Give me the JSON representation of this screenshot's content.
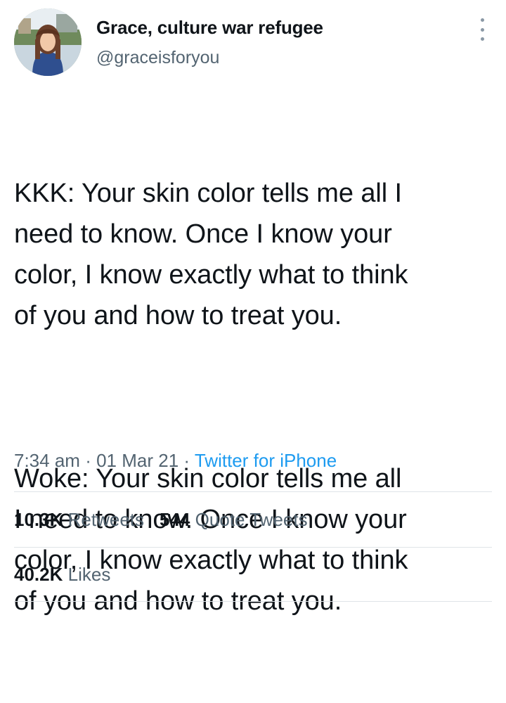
{
  "author": {
    "display_name": "Grace, culture war refugee",
    "handle": "@graceisforyou",
    "avatar_icon": "profile-photo"
  },
  "tweet": {
    "paragraphs": [
      "KKK: Your skin color tells me all I\nneed to know. Once I know your\ncolor, I know exactly what to think\nof you and how to treat you.",
      "Woke: Your skin color tells me all\nI need to know. Once I know your\ncolor, I know exactly what to think\nof you and how to treat you."
    ],
    "time": "7:34 am",
    "date": "01 Mar 21",
    "source": "Twitter for iPhone",
    "separator": "·"
  },
  "stats": {
    "retweets_count": "10.3K",
    "retweets_label": "Retweets",
    "quotes_count": "544",
    "quotes_label": "Quote Tweets",
    "likes_count": "40.2K",
    "likes_label": "Likes"
  },
  "colors": {
    "text": "#0f1419",
    "secondary": "#536471",
    "link": "#1d9bf0",
    "divider": "#dfe4e8"
  }
}
